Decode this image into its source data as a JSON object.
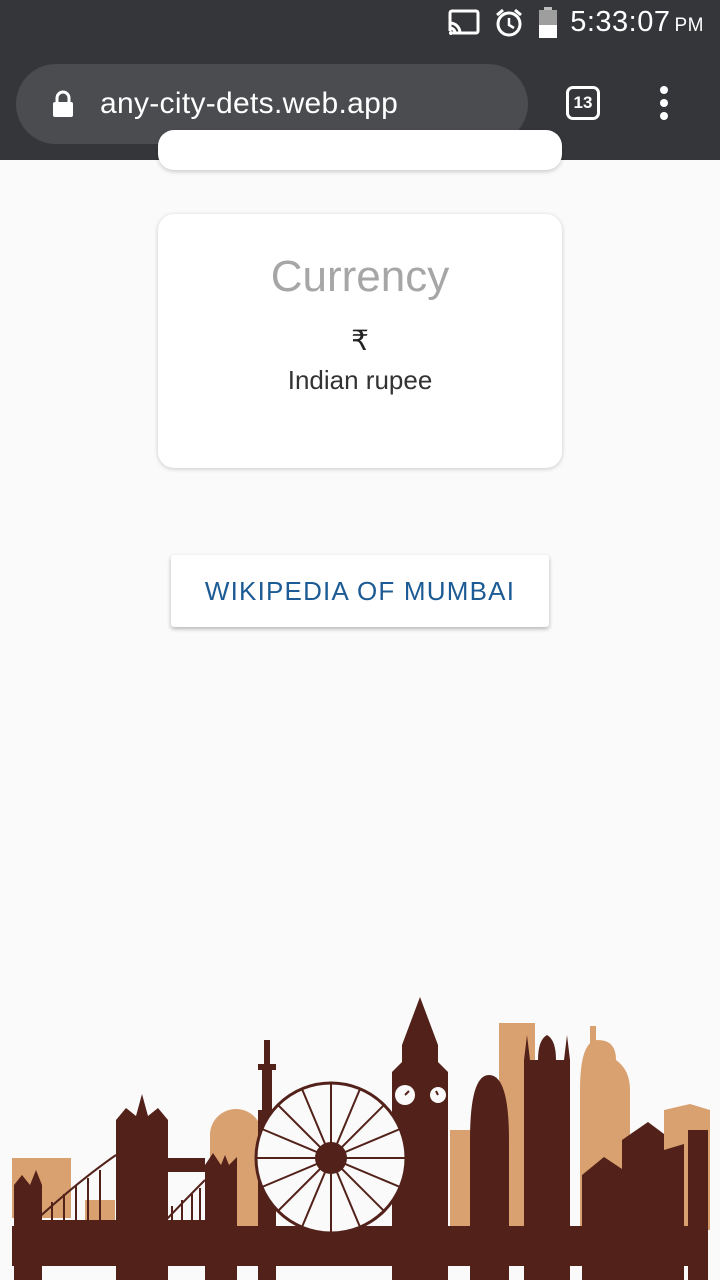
{
  "status_bar": {
    "time": "5:33:07",
    "ampm": "PM",
    "icons": [
      "cast-icon",
      "alarm-icon",
      "battery-icon"
    ]
  },
  "browser": {
    "url": "any-city-dets.web.app",
    "tab_count": "13",
    "icons": [
      "lock-icon",
      "more-vert-icon"
    ]
  },
  "currency_card": {
    "title": "Currency",
    "symbol": "₹",
    "name": "Indian rupee"
  },
  "wiki_button": {
    "label": "WIKIPEDIA OF MUMBAI"
  },
  "colors": {
    "skyline_dark": "#52221a",
    "skyline_light": "#d9a070",
    "button_text": "#1c5b94",
    "title_gray": "#a6a6a6",
    "toolbar": "#35363a"
  }
}
